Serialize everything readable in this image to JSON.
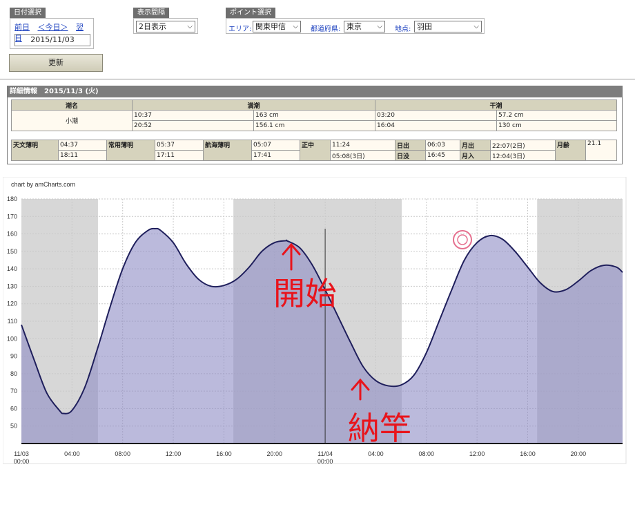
{
  "date_select": {
    "legend": "日付選択",
    "prev": "前日",
    "today": "＜今日＞",
    "next": "翌日",
    "date": "2015/11/03"
  },
  "interval": {
    "legend": "表示間隔",
    "value": "2日表示"
  },
  "point": {
    "legend": "ポイント選択",
    "area_label": "エリア:",
    "area_value": "関東甲信",
    "pref_label": "都道府県:",
    "pref_value": "東京",
    "spot_label": "地点:",
    "spot_value": "羽田"
  },
  "update_button": "更新",
  "detail": {
    "title": "詳細情報　2015/11/3 (火)",
    "tide_name_header": "潮名",
    "high_header": "満潮",
    "low_header": "干潮",
    "tide_name": "小潮",
    "high": [
      {
        "time": "10:37",
        "level": "163 cm"
      },
      {
        "time": "20:52",
        "level": "156.1 cm"
      }
    ],
    "low": [
      {
        "time": "03:20",
        "level": "57.2 cm"
      },
      {
        "time": "16:04",
        "level": "130 cm"
      }
    ],
    "astro_label": "天文薄明",
    "astro": [
      "04:37",
      "18:11"
    ],
    "civil_label": "常用薄明",
    "civil": [
      "05:37",
      "17:11"
    ],
    "nautical_label": "航海薄明",
    "nautical": [
      "05:07",
      "17:41"
    ],
    "noon_label": "正中",
    "noon": [
      "11:24",
      "05:08(3日)"
    ],
    "sunrise_label": "日出",
    "sunrise": "06:03",
    "sunset_label": "日没",
    "sunset": "16:45",
    "moonrise_label": "月出",
    "moonrise": "22:07(2日)",
    "moonset_label": "月入",
    "moonset": "12:04(3日)",
    "moonage_label": "月齢",
    "moonage": "21.1"
  },
  "chart_data": {
    "type": "area",
    "credit": "chart by amCharts.com",
    "x_hours": [
      0,
      1,
      2,
      3,
      3.33,
      4,
      5,
      6,
      7,
      8,
      9,
      10,
      10.6,
      11,
      12,
      13,
      14,
      15,
      16,
      17,
      18,
      19,
      20,
      20.9,
      21,
      22,
      23,
      24,
      25,
      26,
      27,
      28,
      29,
      30,
      31,
      32,
      33,
      34,
      35,
      36,
      37,
      38,
      39,
      40,
      41,
      42,
      43,
      44,
      45,
      46,
      47,
      47.5
    ],
    "y": [
      108,
      88,
      69,
      59,
      57.2,
      59,
      72,
      94,
      118,
      140,
      155,
      162,
      163,
      162,
      155,
      143,
      134,
      130,
      130.5,
      134,
      141,
      150,
      155,
      156.1,
      156,
      152,
      142,
      128,
      113,
      98,
      84,
      76,
      73,
      73.5,
      79,
      92,
      110,
      128,
      145,
      155,
      159,
      157,
      150,
      141,
      132,
      127,
      128,
      133,
      139,
      142,
      141,
      138
    ],
    "ylim": [
      40,
      180
    ],
    "y_ticks": [
      50,
      60,
      70,
      80,
      90,
      100,
      110,
      120,
      130,
      140,
      150,
      160,
      170,
      180
    ],
    "x_ticks": [
      {
        "h": 0,
        "label": "11/03",
        "label2": "00:00"
      },
      {
        "h": 4,
        "label": "04:00"
      },
      {
        "h": 8,
        "label": "08:00"
      },
      {
        "h": 12,
        "label": "12:00"
      },
      {
        "h": 16,
        "label": "16:00"
      },
      {
        "h": 20,
        "label": "20:00"
      },
      {
        "h": 24,
        "label": "11/04",
        "label2": "00:00"
      },
      {
        "h": 28,
        "label": "04:00"
      },
      {
        "h": 32,
        "label": "08:00"
      },
      {
        "h": 36,
        "label": "12:00"
      },
      {
        "h": 40,
        "label": "16:00"
      },
      {
        "h": 44,
        "label": "20:00"
      }
    ],
    "night_bands": [
      [
        0,
        6.05
      ],
      [
        16.75,
        30.05
      ],
      [
        40.75,
        47.5
      ]
    ],
    "current_hour": 24,
    "annotation_start": "開始",
    "annotation_end": "納竿",
    "colors": {
      "line": "#1f1f5c",
      "fill": "#8d8cc4",
      "night": "#d7d7d7",
      "annot": "#e8141c"
    }
  }
}
